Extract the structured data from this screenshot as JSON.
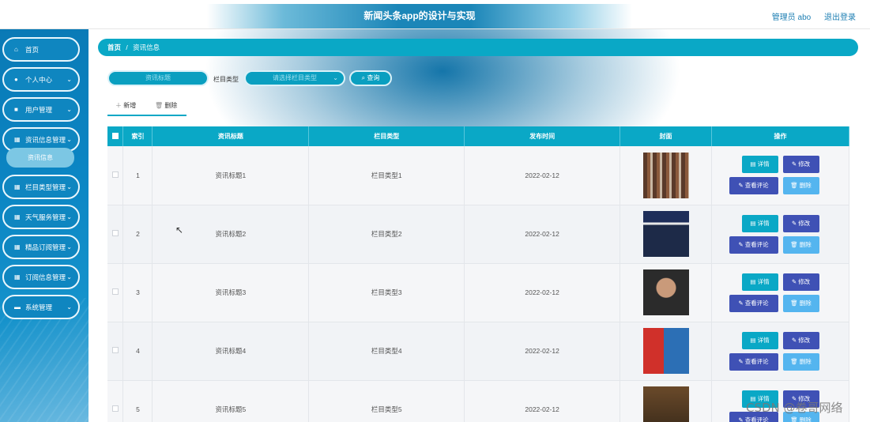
{
  "header": {
    "title": "新闻头条app的设计与实现",
    "user_label": "管理员 abo",
    "logout_label": "退出登录"
  },
  "sidebar": {
    "items": [
      {
        "label": "首页",
        "icon": "home-icon"
      },
      {
        "label": "个人中心",
        "icon": "user-icon"
      },
      {
        "label": "用户管理",
        "icon": "users-icon"
      },
      {
        "label": "资讯信息管理",
        "icon": "grid-icon"
      },
      {
        "label": "栏目类型管理",
        "icon": "grid-icon"
      },
      {
        "label": "天气服务管理",
        "icon": "grid-icon"
      },
      {
        "label": "精品订阅管理",
        "icon": "grid-icon"
      },
      {
        "label": "订阅信息管理",
        "icon": "grid-icon"
      },
      {
        "label": "系统管理",
        "icon": "settings-icon"
      }
    ],
    "sub_item": "资讯信息"
  },
  "breadcrumb": {
    "home": "首页",
    "separator": "/",
    "current": "资讯信息"
  },
  "search": {
    "title_placeholder": "资讯标题",
    "type_label": "栏目类型",
    "type_placeholder": "请选择栏目类型",
    "button_label": "查询"
  },
  "toolbar": {
    "add_label": "新增",
    "delete_label": "删除"
  },
  "table": {
    "columns": [
      "索引",
      "资讯标题",
      "栏目类型",
      "发布时间",
      "封面",
      "操作"
    ],
    "rows": [
      {
        "index": "1",
        "title": "资讯标题1",
        "type": "栏目类型1",
        "date": "2022-02-12"
      },
      {
        "index": "2",
        "title": "资讯标题2",
        "type": "栏目类型2",
        "date": "2022-02-12"
      },
      {
        "index": "3",
        "title": "资讯标题3",
        "type": "栏目类型3",
        "date": "2022-02-12"
      },
      {
        "index": "4",
        "title": "资讯标题4",
        "type": "栏目类型4",
        "date": "2022-02-12"
      },
      {
        "index": "5",
        "title": "资讯标题5",
        "type": "栏目类型5",
        "date": "2022-02-12"
      }
    ],
    "actions": {
      "detail": "详情",
      "edit": "修改",
      "comment": "查看评论",
      "delete": "删除"
    }
  },
  "watermark": "CSDN @卷哥网络",
  "colors": {
    "accent": "#0aa8c6",
    "sidebar": "#0b86c4",
    "button_dark": "#3f51b5",
    "button_light": "#54b5ef"
  }
}
